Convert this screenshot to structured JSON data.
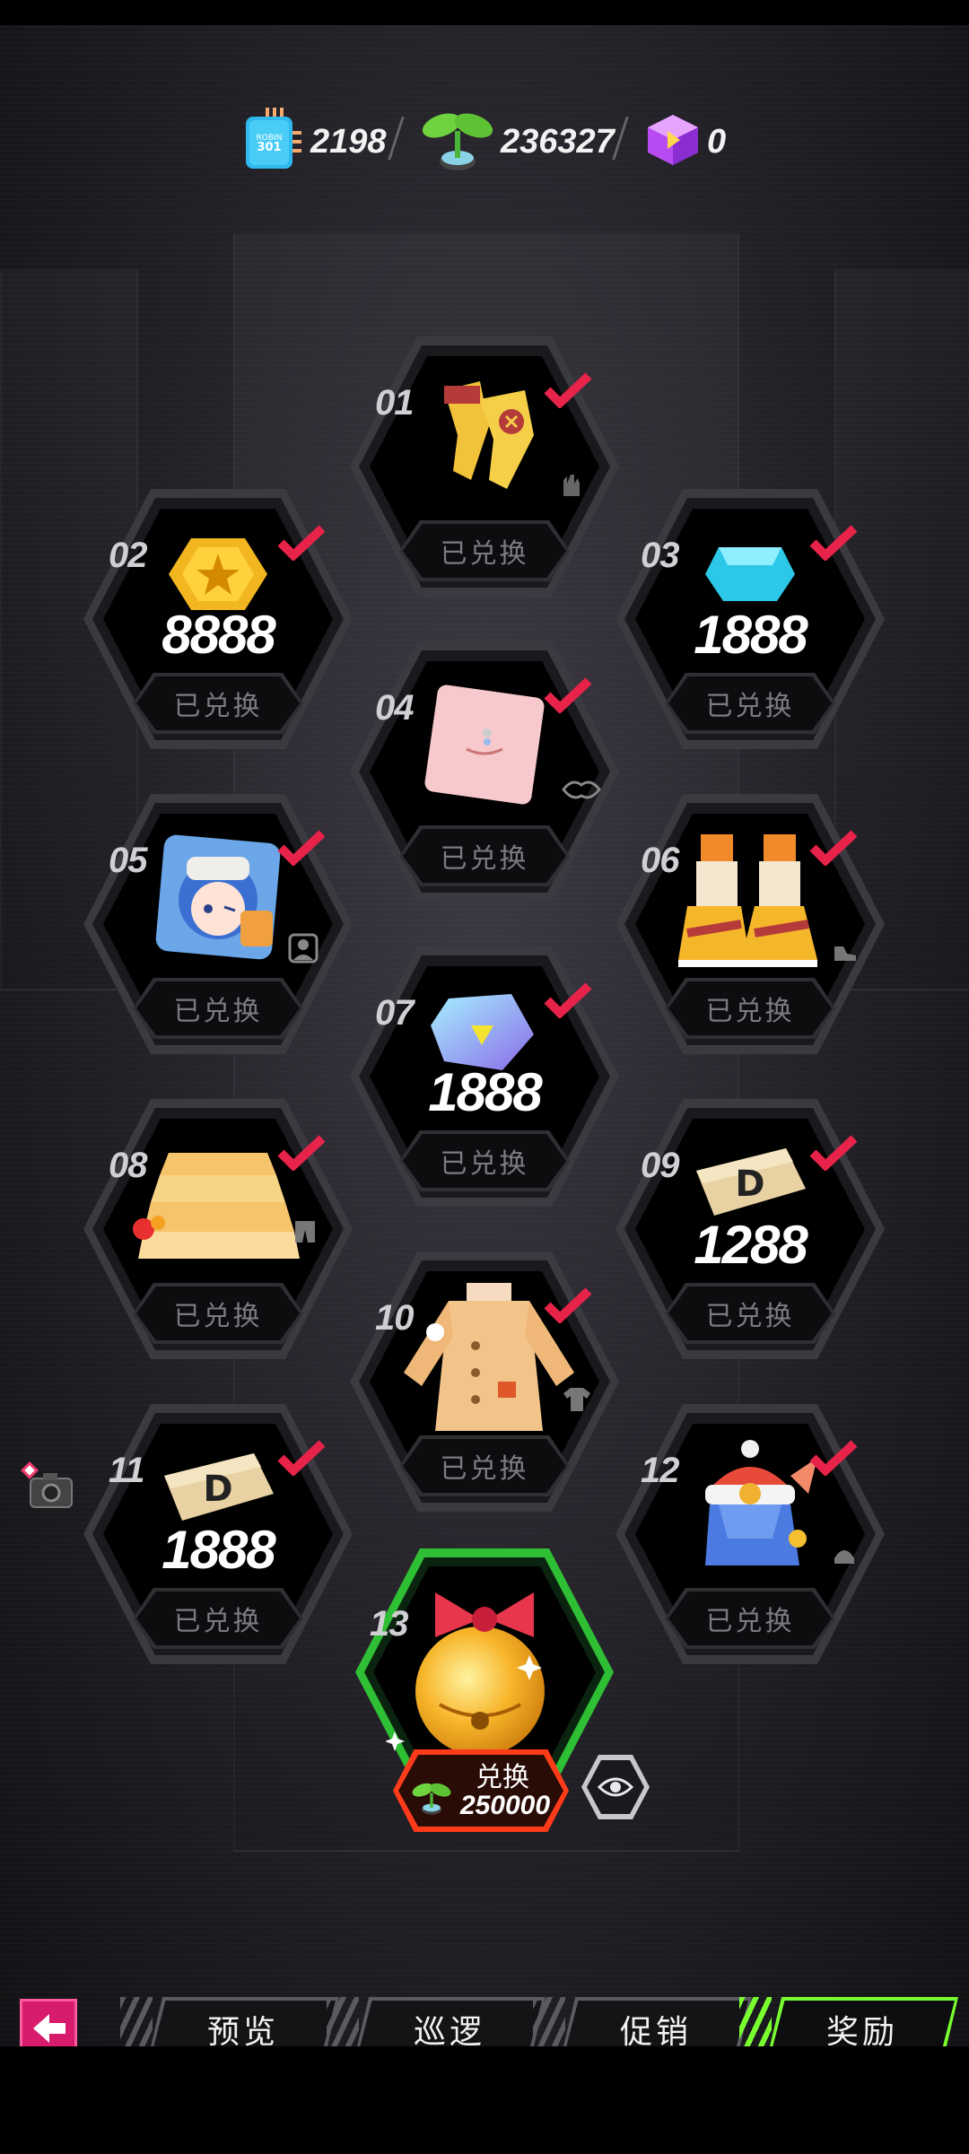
{
  "currencies": [
    {
      "icon": "chip-card-icon",
      "value": "2198"
    },
    {
      "icon": "sprout-icon",
      "value": "236327"
    },
    {
      "icon": "purple-cube-icon",
      "value": "0"
    }
  ],
  "colors": {
    "accent_green": "#79ff2f",
    "check_red": "#e8234a",
    "featured_border": "#2fbf34",
    "redeem_border": "#ff3b1a",
    "back_button": "#d81b6a"
  },
  "status_redeemed": "已兑换",
  "cards": [
    {
      "num": "01",
      "amount": "",
      "item": "gloves-icon",
      "slot": "glove-slot-icon"
    },
    {
      "num": "02",
      "amount": "8888",
      "item": "gold-coin-icon",
      "slot": ""
    },
    {
      "num": "03",
      "amount": "1888",
      "item": "diamond-icon",
      "slot": ""
    },
    {
      "num": "04",
      "amount": "",
      "item": "mouth-piercing-icon",
      "slot": "lips-slot-icon"
    },
    {
      "num": "05",
      "amount": "",
      "item": "avatar-portrait-icon",
      "slot": "portrait-slot-icon"
    },
    {
      "num": "06",
      "amount": "",
      "item": "boots-icon",
      "slot": "shoe-slot-icon"
    },
    {
      "num": "07",
      "amount": "1888",
      "item": "crystal-tag-icon",
      "slot": ""
    },
    {
      "num": "08",
      "amount": "",
      "item": "ruffle-skirt-icon",
      "slot": "pants-slot-icon"
    },
    {
      "num": "09",
      "amount": "1288",
      "item": "d-ticket-icon",
      "slot": ""
    },
    {
      "num": "10",
      "amount": "",
      "item": "coat-icon",
      "slot": "shirt-slot-icon"
    },
    {
      "num": "11",
      "amount": "1888",
      "item": "d-ticket-icon",
      "slot": ""
    },
    {
      "num": "12",
      "amount": "",
      "item": "hat-hair-icon",
      "slot": "head-slot-icon"
    }
  ],
  "featured": {
    "num": "13",
    "label": "兑换",
    "cost": "250000",
    "item": "golden-bell-icon"
  },
  "tabs": [
    {
      "label": "预览",
      "active": false
    },
    {
      "label": "巡逻",
      "active": false
    },
    {
      "label": "促销",
      "active": false
    },
    {
      "label": "奖励",
      "active": true
    }
  ]
}
